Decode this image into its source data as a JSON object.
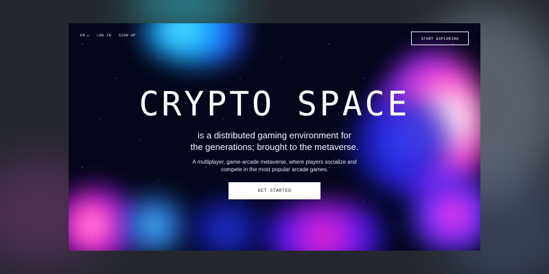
{
  "nav": {
    "language": "EN",
    "login_label": "LOG IN",
    "signup_label": "SIGN UP",
    "cta_label": "START EXPLORING"
  },
  "hero": {
    "title": "CRYPTO SPACE",
    "subtitle_line_1": "is a distributed gaming environment for",
    "subtitle_line_2": "the generations; brought to the metaverse.",
    "body_line_1": "A multiplayer, game-arcade metaverse, where players socialize and",
    "body_line_2": "compete in the most popular arcade games.",
    "button_label": "GET STARTED"
  },
  "icons": {
    "language_dropdown": "chevron-down-icon"
  },
  "colors": {
    "page_background": "#24272d",
    "card_background": "#05061a",
    "text_primary": "#ffffff",
    "button_background": "#ffffff",
    "button_text": "#121321",
    "accent_cyan": "#12a9ff",
    "accent_pink": "#ff3cd0",
    "accent_blue": "#2750ff"
  }
}
